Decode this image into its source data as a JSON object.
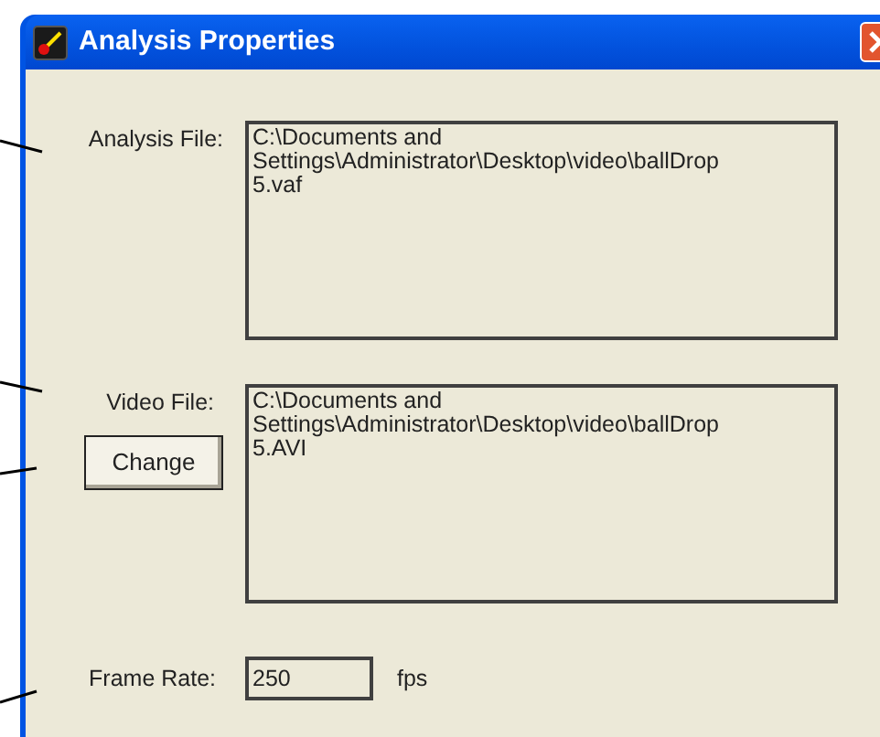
{
  "window": {
    "title": "Analysis Properties"
  },
  "analysis_file": {
    "label": "Analysis File:",
    "value_lines": [
      "C:\\Documents and",
      "Settings\\Administrator\\Desktop\\video\\ballDrop",
      "5.vaf"
    ]
  },
  "video_file": {
    "label": "Video File:",
    "button": "Change",
    "value_lines": [
      "C:\\Documents and",
      "Settings\\Administrator\\Desktop\\video\\ballDrop",
      "5.AVI"
    ]
  },
  "frame_rate": {
    "label": "Frame Rate:",
    "value": "250",
    "unit": "fps"
  }
}
